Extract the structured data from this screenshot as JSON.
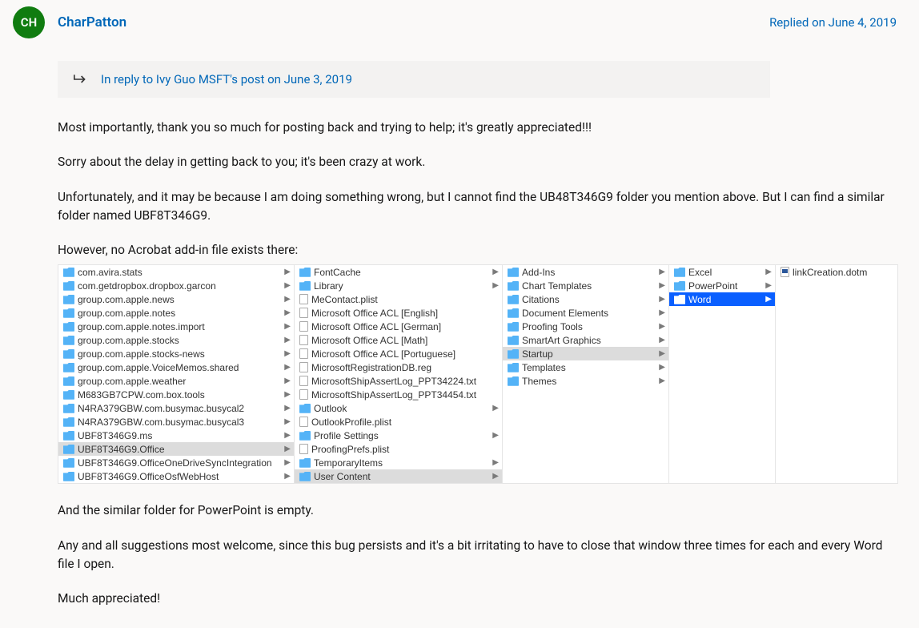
{
  "avatar_initials": "CH",
  "author_name": "CharPatton",
  "reply_timestamp": "Replied on June 4, 2019",
  "in_reply_to": "In reply to Ivy Guo MSFT's post on June 3, 2019",
  "paragraphs": [
    "Most importantly, thank you so much for posting back and trying to help; it's greatly appreciated!!!",
    "Sorry about the delay in getting back to you; it's been crazy at work.",
    "Unfortunately, and it may be because I am doing something wrong, but I cannot find the UB48T346G9 folder you mention above. But I can find a similar folder named UBF8T346G9.",
    "However, no Acrobat add-in file exists there:",
    "And the similar folder for PowerPoint is empty.",
    "Any and all suggestions most welcome, since this bug persists and it's a bit irritating to have to close that window three times for each and every Word file I open.",
    "Much appreciated!"
  ],
  "finder": {
    "col1": [
      {
        "t": "folder",
        "n": "com.avira.stats",
        "c": true
      },
      {
        "t": "folder",
        "n": "com.getdropbox.dropbox.garcon",
        "c": true
      },
      {
        "t": "folder",
        "n": "group.com.apple.news",
        "c": true
      },
      {
        "t": "folder",
        "n": "group.com.apple.notes",
        "c": true
      },
      {
        "t": "folder",
        "n": "group.com.apple.notes.import",
        "c": true
      },
      {
        "t": "folder",
        "n": "group.com.apple.stocks",
        "c": true
      },
      {
        "t": "folder",
        "n": "group.com.apple.stocks-news",
        "c": true
      },
      {
        "t": "folder",
        "n": "group.com.apple.VoiceMemos.shared",
        "c": true
      },
      {
        "t": "folder",
        "n": "group.com.apple.weather",
        "c": true
      },
      {
        "t": "folder",
        "n": "M683GB7CPW.com.box.tools",
        "c": true
      },
      {
        "t": "folder",
        "n": "N4RA379GBW.com.busymac.busycal2",
        "c": true
      },
      {
        "t": "folder",
        "n": "N4RA379GBW.com.busymac.busycal3",
        "c": true
      },
      {
        "t": "folder",
        "n": "UBF8T346G9.ms",
        "c": true
      },
      {
        "t": "folder",
        "n": "UBF8T346G9.Office",
        "c": true,
        "sel": "grey"
      },
      {
        "t": "folder",
        "n": "UBF8T346G9.OfficeOneDriveSyncIntegration",
        "c": true
      },
      {
        "t": "folder",
        "n": "UBF8T346G9.OfficeOsfWebHost",
        "c": true
      }
    ],
    "col2": [
      {
        "t": "folder",
        "n": "FontCache",
        "c": true
      },
      {
        "t": "folder",
        "n": "Library",
        "c": true
      },
      {
        "t": "file",
        "n": "MeContact.plist"
      },
      {
        "t": "file",
        "n": "Microsoft Office ACL [English]"
      },
      {
        "t": "file",
        "n": "Microsoft Office ACL [German]"
      },
      {
        "t": "file",
        "n": "Microsoft Office ACL [Math]"
      },
      {
        "t": "file",
        "n": "Microsoft Office ACL [Portuguese]"
      },
      {
        "t": "file",
        "n": "MicrosoftRegistrationDB.reg"
      },
      {
        "t": "file",
        "n": "MicrosoftShipAssertLog_PPT34224.txt"
      },
      {
        "t": "file",
        "n": "MicrosoftShipAssertLog_PPT34454.txt"
      },
      {
        "t": "folder",
        "n": "Outlook",
        "c": true
      },
      {
        "t": "file",
        "n": "OutlookProfile.plist"
      },
      {
        "t": "folder",
        "n": "Profile Settings",
        "c": true
      },
      {
        "t": "file",
        "n": "ProofingPrefs.plist"
      },
      {
        "t": "folder",
        "n": "TemporaryItems",
        "c": true
      },
      {
        "t": "folder",
        "n": "User Content",
        "c": true,
        "sel": "grey"
      }
    ],
    "col3": [
      {
        "t": "folder",
        "n": "Add-Ins",
        "c": true
      },
      {
        "t": "folder",
        "n": "Chart Templates",
        "c": true
      },
      {
        "t": "folder",
        "n": "Citations",
        "c": true
      },
      {
        "t": "folder",
        "n": "Document Elements",
        "c": true
      },
      {
        "t": "folder",
        "n": "Proofing Tools",
        "c": true
      },
      {
        "t": "folder",
        "n": "SmartArt Graphics",
        "c": true
      },
      {
        "t": "folder",
        "n": "Startup",
        "c": true,
        "sel": "grey"
      },
      {
        "t": "folder",
        "n": "Templates",
        "c": true
      },
      {
        "t": "folder",
        "n": "Themes",
        "c": true
      }
    ],
    "col4": [
      {
        "t": "folder",
        "n": "Excel",
        "c": true
      },
      {
        "t": "folder",
        "n": "PowerPoint",
        "c": true
      },
      {
        "t": "folder",
        "n": "Word",
        "c": true,
        "sel": "blue"
      }
    ],
    "col5": [
      {
        "t": "dotm",
        "n": "linkCreation.dotm"
      }
    ]
  }
}
